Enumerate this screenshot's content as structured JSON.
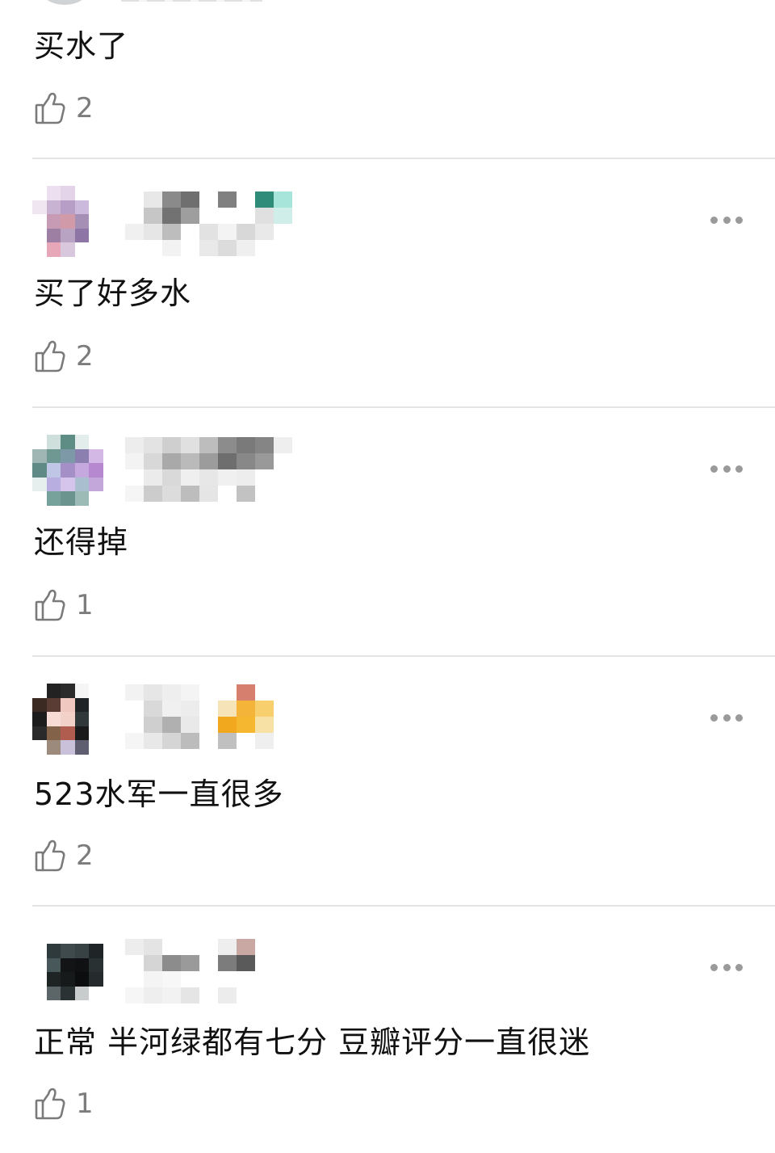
{
  "comments": [
    {
      "text": "买水了",
      "likes": "2",
      "partial": true
    },
    {
      "text": "买了好多水",
      "likes": "2"
    },
    {
      "text": "还得掉",
      "likes": "1"
    },
    {
      "text": "523水军一直很多",
      "likes": "2"
    },
    {
      "text": "正常 半河绿都有七分 豆瓣评分一直很迷",
      "likes": "1"
    }
  ],
  "icons": {
    "like": "thumbs-up-icon",
    "more": "more-options-icon"
  },
  "colors": {
    "text": "#111111",
    "like_count": "#7c7c7c",
    "divider": "#e4e4e4",
    "more_dots": "#9a9a9a"
  }
}
